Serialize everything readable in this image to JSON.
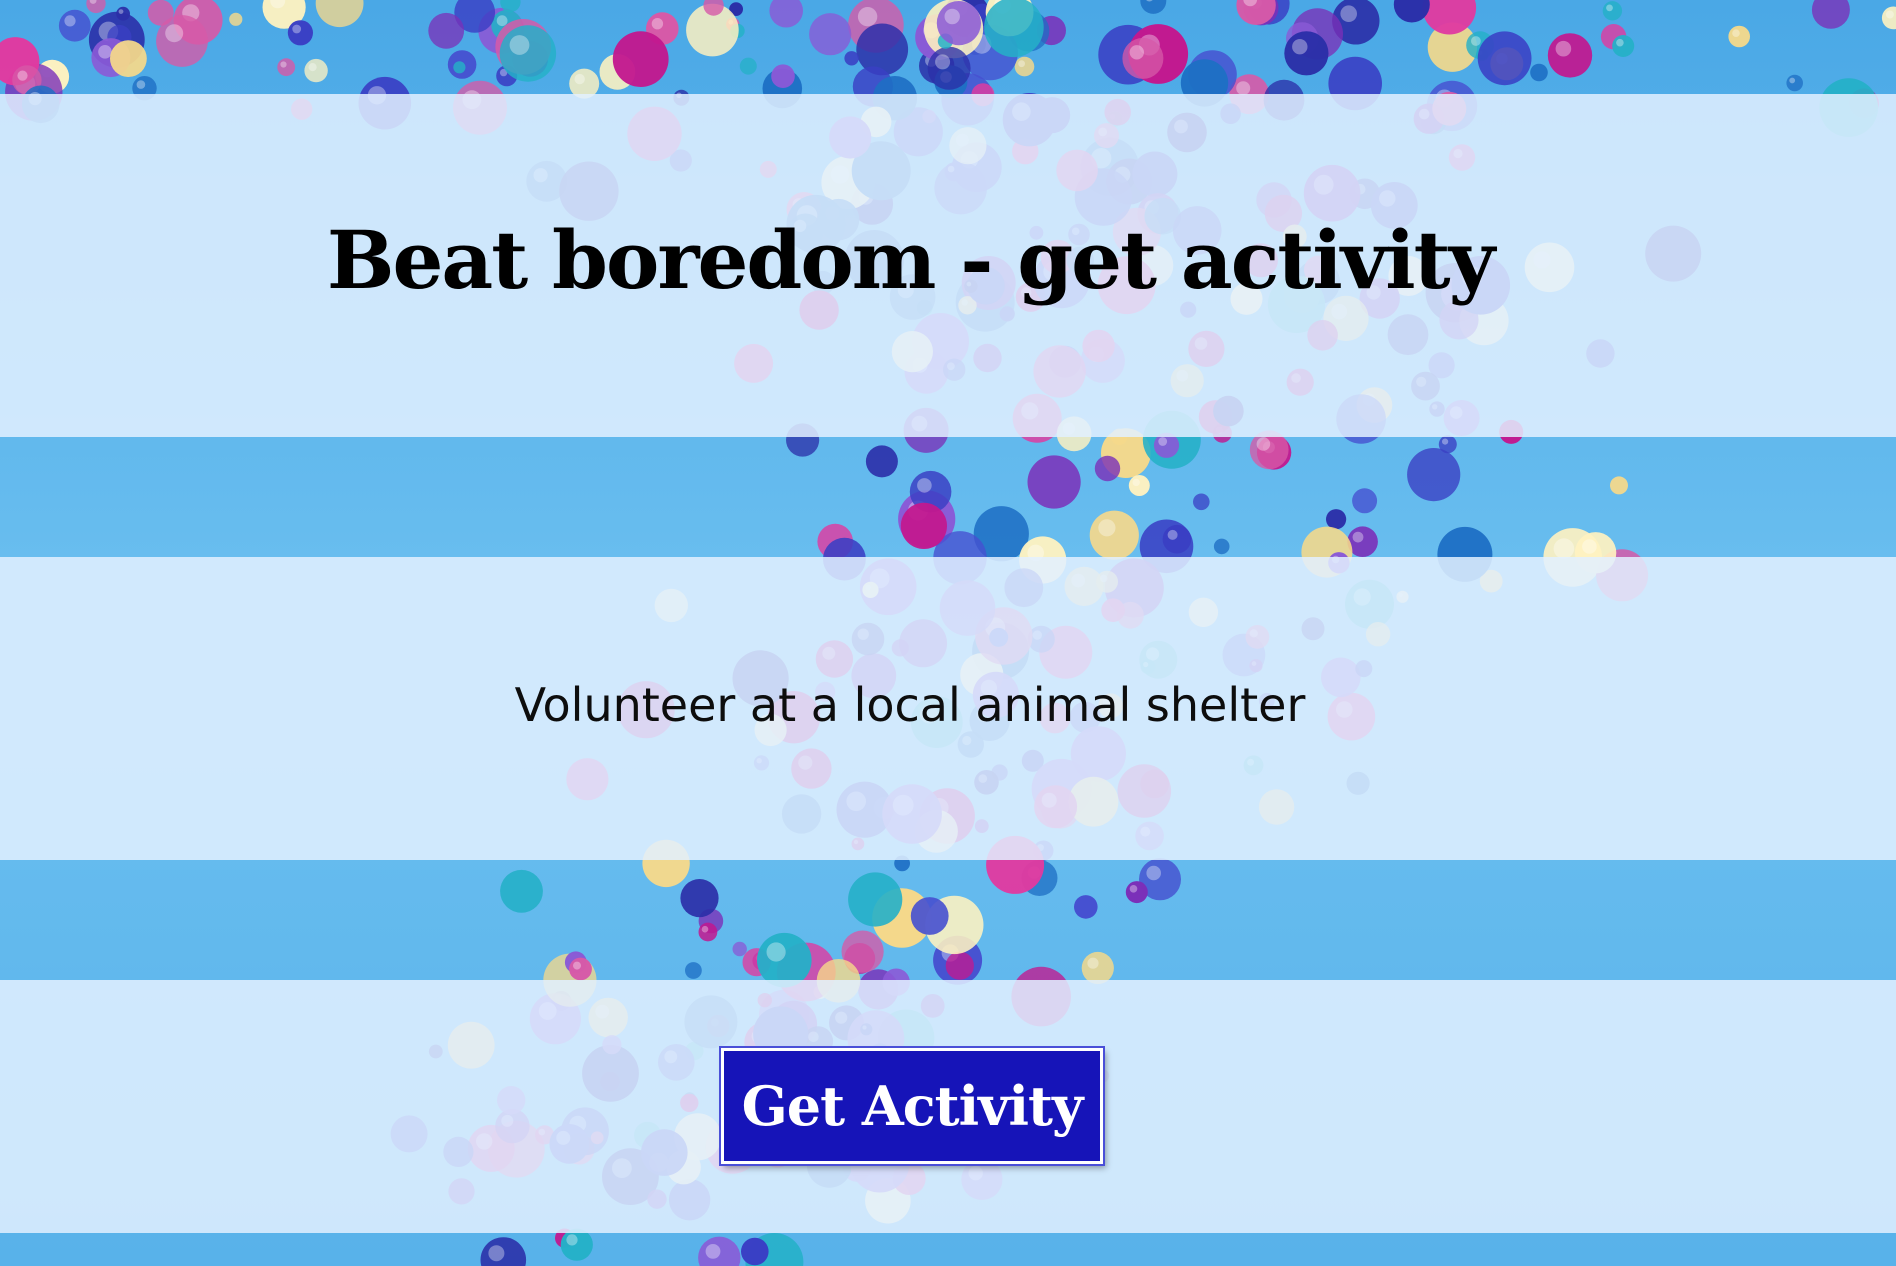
{
  "page": {
    "title": "Beat boredom - get activity",
    "activity_text": "Volunteer at a local animal shelter",
    "button_label": "Get Activity"
  },
  "colors": {
    "button_bg": "#1614b8",
    "band_overlay": "#e2f0ff",
    "sky": "#5ab6ec"
  },
  "background": {
    "description_icon": "balloons-background-image"
  }
}
